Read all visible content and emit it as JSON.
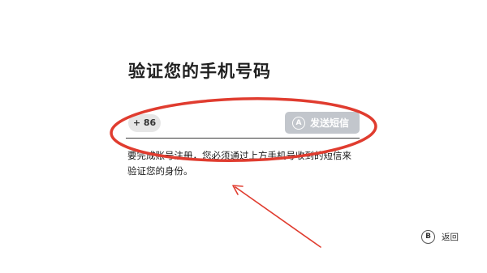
{
  "page": {
    "title": "验证您的手机号码"
  },
  "phone": {
    "country_code": "+ 86",
    "value": "",
    "send_button": {
      "badge": "A",
      "label": "发送短信"
    }
  },
  "description": {
    "line1": "要完成账号注册，您必须通过上方手机号收到的短信来",
    "line2": "验证您的身份。"
  },
  "footer": {
    "back_badge": "B",
    "back_label": "返回"
  },
  "colors": {
    "annotation_red": "#e03c2f",
    "button_disabled": "#c2c6cc"
  }
}
